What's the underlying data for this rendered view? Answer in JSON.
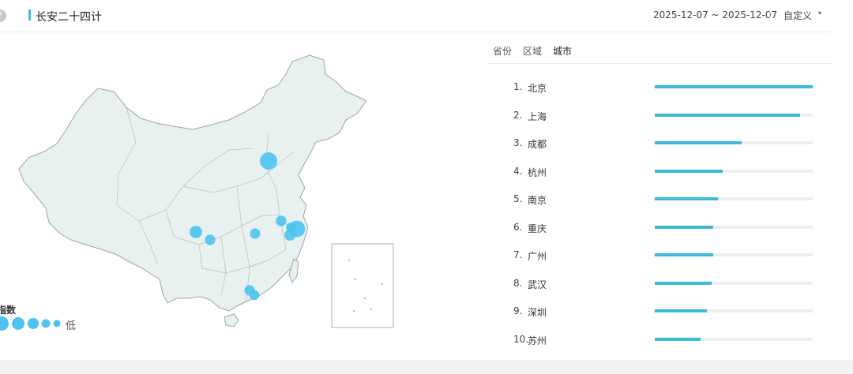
{
  "header": {
    "help_icon": "?",
    "title": "长安二十四计",
    "date_range": "2025-12-07 ~ 2025-12-07",
    "custom_label": "自定义",
    "dropdown_icon": "▾"
  },
  "tabs": [
    {
      "label": "省份",
      "active": false
    },
    {
      "label": "区域",
      "active": false
    },
    {
      "label": "城市",
      "active": true
    }
  ],
  "legend": {
    "title": "指数",
    "low_label": "低"
  },
  "colors": {
    "accent": "#3db9d9",
    "bubble": "#4dc3ee",
    "map_fill": "#e8f0f0",
    "map_stroke": "#9aa5a5"
  },
  "chart_data": {
    "type": "bar",
    "categories": [
      "北京",
      "上海",
      "成都",
      "杭州",
      "南京",
      "重庆",
      "广州",
      "武汉",
      "深圳",
      "苏州"
    ],
    "ranks": [
      "1.",
      "2.",
      "3.",
      "4.",
      "5.",
      "6.",
      "7.",
      "8.",
      "9.",
      "10."
    ],
    "values": [
      100,
      92,
      55,
      43,
      40,
      37,
      37,
      36,
      33,
      29
    ],
    "xlim": [
      0,
      100
    ]
  }
}
